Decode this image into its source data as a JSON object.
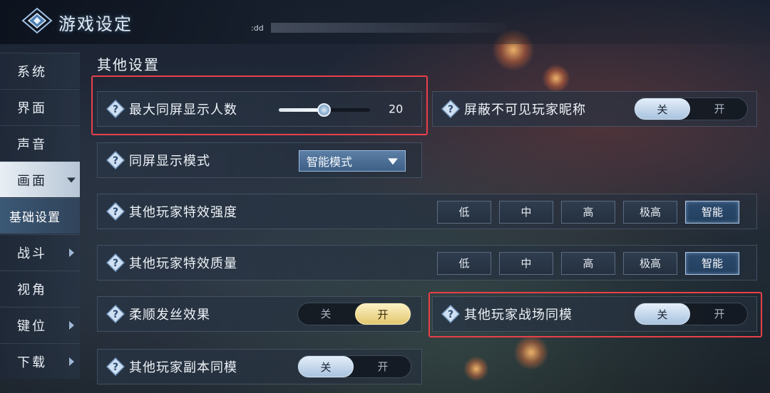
{
  "window": {
    "title": "游戏设定",
    "tag": ":dd"
  },
  "sidebar": {
    "items": [
      {
        "label": "系统",
        "arrow": ""
      },
      {
        "label": "界面",
        "arrow": ""
      },
      {
        "label": "声音",
        "arrow": ""
      },
      {
        "label": "画面",
        "arrow": "down",
        "state": "active"
      },
      {
        "label": "基础设置",
        "arrow": "",
        "state": "sub-active"
      },
      {
        "label": "战斗",
        "arrow": "right"
      },
      {
        "label": "视角",
        "arrow": ""
      },
      {
        "label": "键位",
        "arrow": "right"
      },
      {
        "label": "下载",
        "arrow": "right"
      }
    ]
  },
  "section": {
    "title": "其他设置"
  },
  "settings": {
    "max_players": {
      "label": "最大同屏显示人数",
      "value": "20",
      "fill_fraction": 0.49
    },
    "hide_names": {
      "label": "屏蔽不可见玩家昵称",
      "off": "关",
      "on": "开",
      "selected": "off"
    },
    "display_mode": {
      "label": "同屏显示模式",
      "value": "智能模式"
    },
    "effect_intensity": {
      "label": "其他玩家特效强度",
      "options": [
        "低",
        "中",
        "高",
        "极高",
        "智能"
      ],
      "selected": "智能"
    },
    "effect_quality": {
      "label": "其他玩家特效质量",
      "options": [
        "低",
        "中",
        "高",
        "极高",
        "智能"
      ],
      "selected": "智能"
    },
    "hair_effect": {
      "label": "柔顺发丝效果",
      "off": "关",
      "on": "开",
      "selected": "on"
    },
    "battlefield_model": {
      "label": "其他玩家战场同模",
      "off": "关",
      "on": "开",
      "selected": "off"
    },
    "dungeon_model": {
      "label": "其他玩家副本同模",
      "off": "关",
      "on": "开",
      "selected": "off"
    }
  },
  "colors": {
    "highlight": "#e8404a",
    "toggle_on": "#e3c76d",
    "toggle_off": "#a9c3df",
    "accent": "#3e5f86"
  },
  "icons": {
    "help": "question-diamond-icon",
    "logo": "diamond-logo-icon"
  }
}
